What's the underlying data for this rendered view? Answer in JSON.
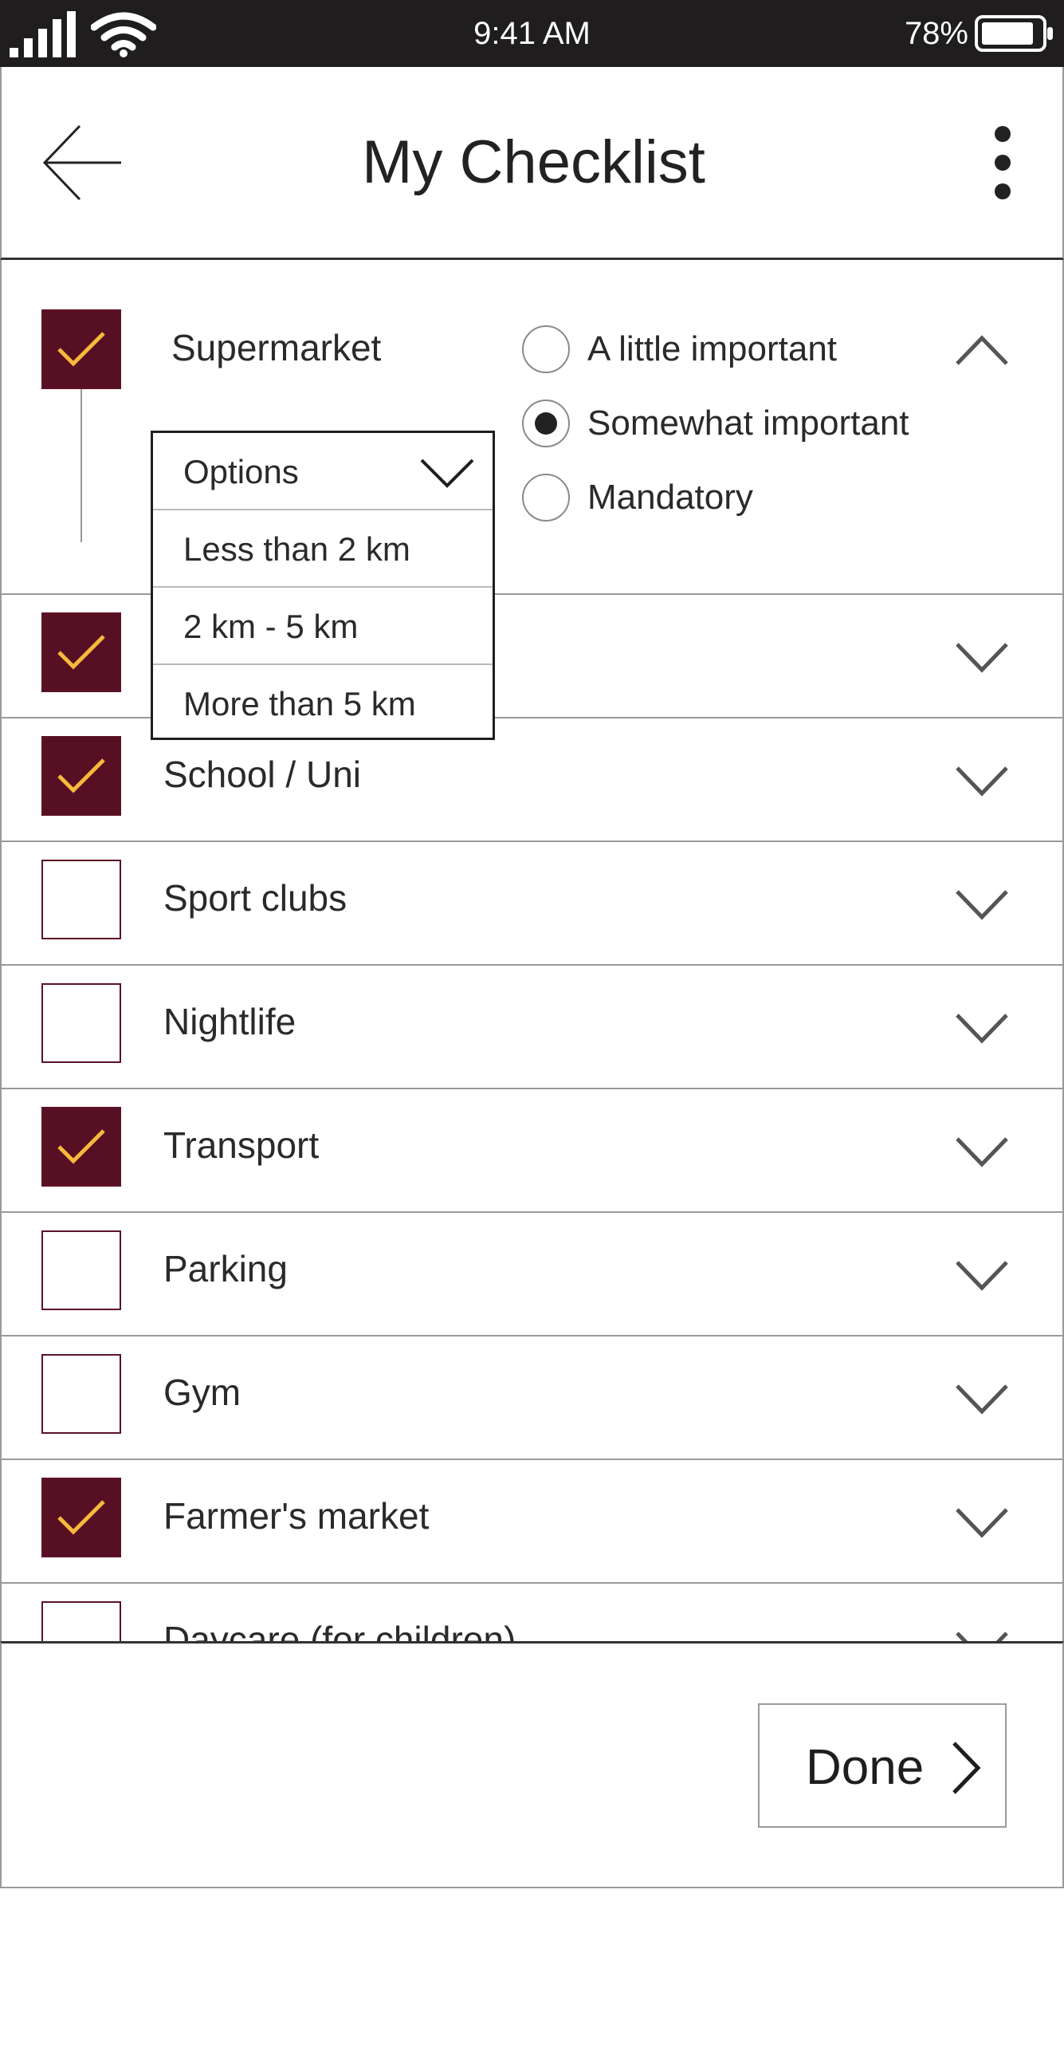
{
  "status_bar": {
    "time": "9:41 AM",
    "battery": "78%",
    "icons": [
      "signal-icon",
      "wifi-icon",
      "battery-icon"
    ]
  },
  "header": {
    "title": "My Checklist",
    "back_icon": "arrow-left-icon",
    "menu_icon": "more-vertical-icon"
  },
  "colors": {
    "checkbox_fill": "#560f23",
    "checkmark": "#f6b93b",
    "status_bar": "#1f1d1e"
  },
  "items": [
    {
      "label": "Supermarket",
      "checked": true,
      "expanded": true
    },
    {
      "label": "",
      "checked": true,
      "expanded": false
    },
    {
      "label": "School / Uni",
      "checked": true,
      "expanded": false
    },
    {
      "label": "Sport clubs",
      "checked": false,
      "expanded": false
    },
    {
      "label": "Nightlife",
      "checked": false,
      "expanded": false
    },
    {
      "label": "Transport",
      "checked": true,
      "expanded": false
    },
    {
      "label": "Parking",
      "checked": false,
      "expanded": false
    },
    {
      "label": "Gym",
      "checked": false,
      "expanded": false
    },
    {
      "label": "Farmer's market",
      "checked": true,
      "expanded": false
    },
    {
      "label": "Daycare (for children)",
      "checked": false,
      "expanded": false
    }
  ],
  "importance": {
    "options": [
      "A little important",
      "Somewhat important",
      "Mandatory"
    ],
    "selected": "Somewhat important"
  },
  "distance_dropdown": {
    "header": "Options",
    "options": [
      "Less than 2 km",
      "2 km - 5 km",
      "More than 5 km"
    ]
  },
  "footer": {
    "done_label": "Done"
  }
}
